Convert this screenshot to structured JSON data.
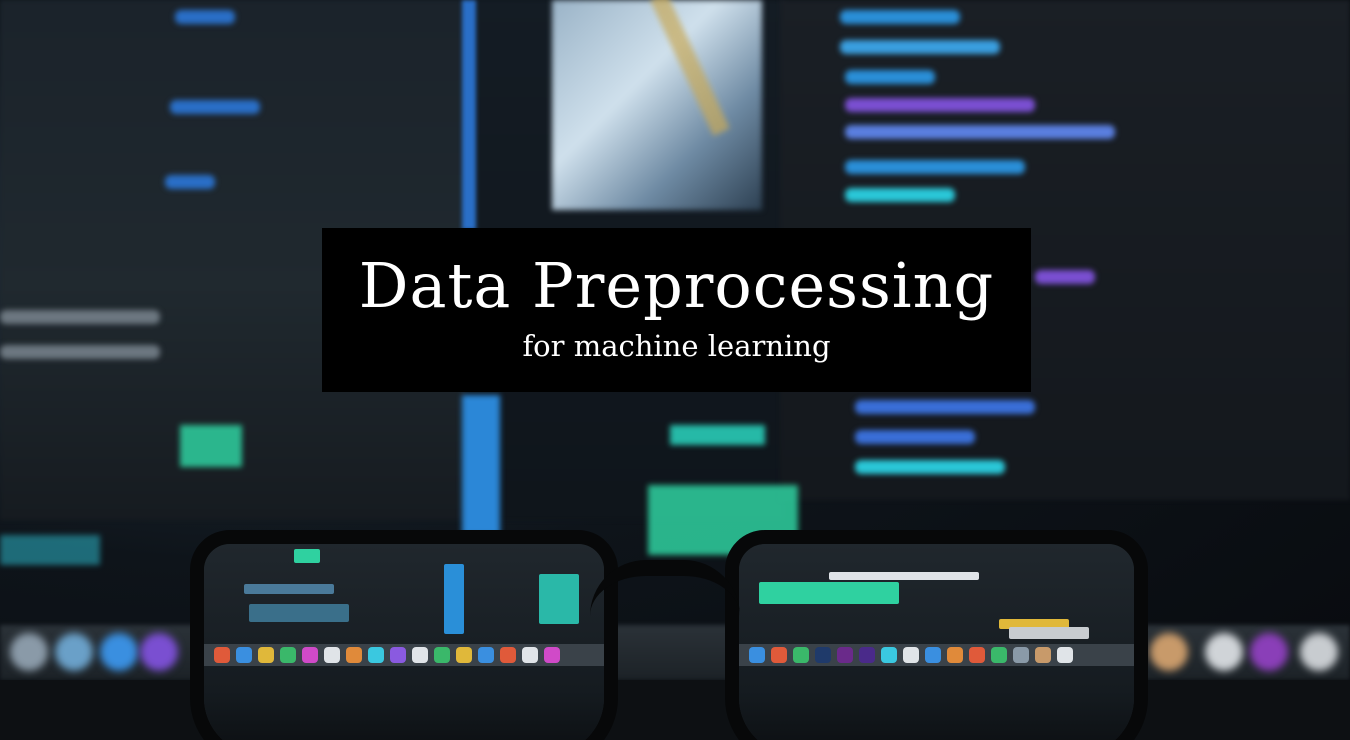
{
  "banner": {
    "title": "Data Preprocessing",
    "subtitle": "for machine learning"
  },
  "colors": {
    "banner_background": "#000000",
    "banner_text": "#ffffff",
    "code_blue": "#2a8fd8",
    "code_purple": "#7a4fd1",
    "code_green": "#2fd1a0"
  }
}
